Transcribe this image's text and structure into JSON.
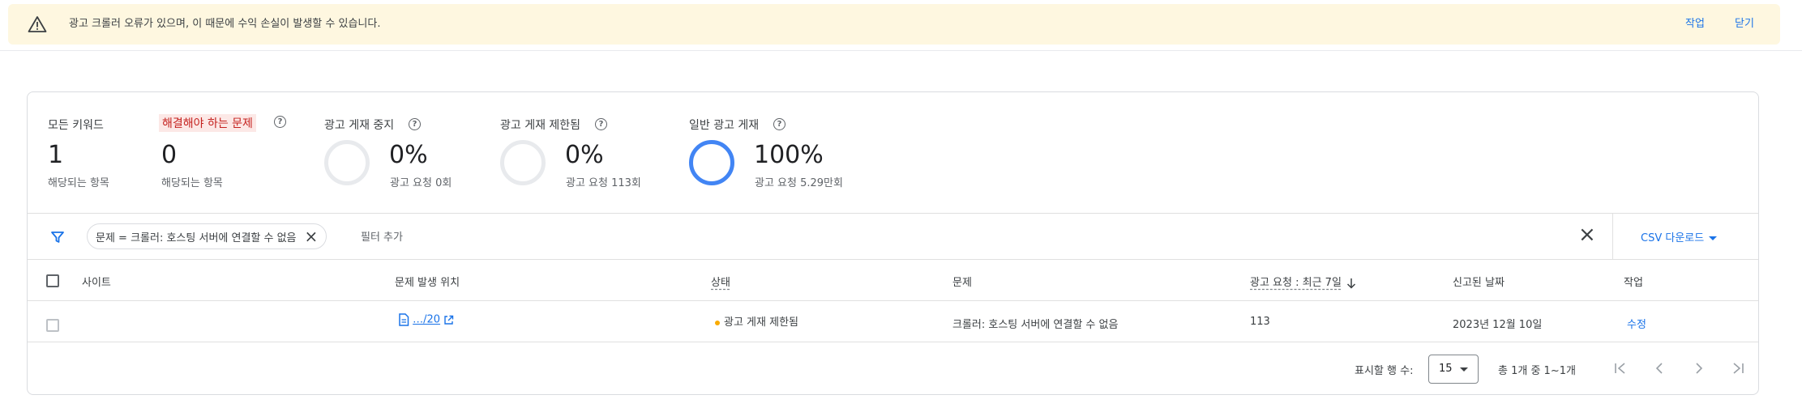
{
  "banner": {
    "message": "광고 크롤러 오류가 있으며, 이 때문에 수익 손실이 발생할 수 있습니다.",
    "action_label": "작업",
    "close_label": "닫기"
  },
  "summary": {
    "all_keywords": {
      "label": "모든 키워드",
      "value": "1",
      "sub": "해당되는 항목"
    },
    "issues_to_fix": {
      "label": "해결해야 하는 문제",
      "value": "0",
      "sub": "해당되는 항목"
    },
    "ad_serving_stopped": {
      "label": "광고 게재 중지",
      "value": "0%",
      "sub": "광고 요청 0회",
      "fill": 0
    },
    "ad_serving_limited": {
      "label": "광고 게재 제한됨",
      "value": "0%",
      "sub": "광고 요청 113회",
      "fill": 0
    },
    "general_ad_serving": {
      "label": "일반 광고 게재",
      "value": "100%",
      "sub": "광고 요청 5.29만회",
      "fill": 100
    }
  },
  "filters": {
    "active_chip": "문제 = 크롤러: 호스팅 서버에 연결할 수 없음",
    "add_placeholder": "필터 추가",
    "csv_label": "CSV 다운로드"
  },
  "table": {
    "headers": {
      "site": "사이트",
      "location": "문제 발생 위치",
      "status": "상태",
      "issue": "문제",
      "ad_requests": "광고 요청 : 최근 7일",
      "reported_date": "신고된 날짜",
      "action": "작업"
    },
    "rows": [
      {
        "site": "",
        "location": "…/20",
        "status": "광고 게재 제한됨",
        "issue": "크롤러: 호스팅 서버에 연결할 수 없음",
        "ad_requests": "113",
        "reported_date": "2023년 12월 10일",
        "action": "수정"
      }
    ]
  },
  "pagination": {
    "rows_label": "표시할 행 수:",
    "rows_value": "15",
    "range_text": "총 1개 중 1~1개"
  },
  "colors": {
    "accent": "#1a73e8",
    "warning_bg": "#fef7e0",
    "alert_bg": "#fce8e6",
    "alert_text": "#c5221f",
    "ring_full": "#4285f4",
    "status_dot": "#f9ab00"
  },
  "icons": {
    "banner": "warning-triangle-icon",
    "filter": "filter-funnel-icon",
    "help": "help-circle-icon",
    "document": "document-icon",
    "external": "open-in-new-icon",
    "sort": "arrow-down-icon",
    "clear": "close-icon"
  }
}
